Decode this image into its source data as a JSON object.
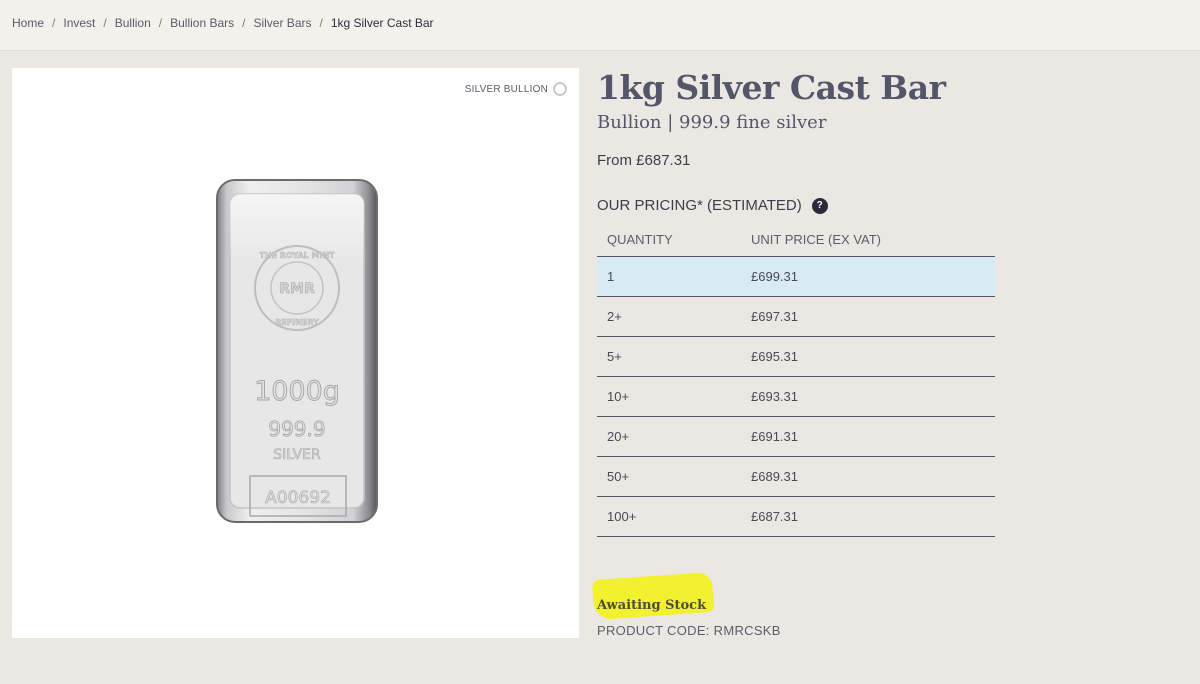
{
  "breadcrumb": {
    "items": [
      "Home",
      "Invest",
      "Bullion",
      "Bullion Bars",
      "Silver Bars"
    ],
    "current": "1kg Silver Cast Bar",
    "separator": "/"
  },
  "image": {
    "badge_label": "SILVER BULLION",
    "bar_text": {
      "brand_top": "THE ROYAL MINT",
      "brand_bottom": "REFINERY",
      "logo": "RMR",
      "weight": "1000g",
      "purity": "999.9",
      "metal": "SILVER",
      "serial": "A00692"
    }
  },
  "product": {
    "title": "1kg Silver Cast Bar",
    "subtitle": "Bullion | 999.9 fine silver",
    "from_price": "From £687.31",
    "pricing_heading": "OUR PRICING* (ESTIMATED)",
    "help_icon": "?",
    "pricing_table": {
      "headers": [
        "QUANTITY",
        "UNIT PRICE (EX VAT)"
      ],
      "rows": [
        {
          "qty": "1",
          "price": "£699.31",
          "selected": true
        },
        {
          "qty": "2+",
          "price": "£697.31",
          "selected": false
        },
        {
          "qty": "5+",
          "price": "£695.31",
          "selected": false
        },
        {
          "qty": "10+",
          "price": "£693.31",
          "selected": false
        },
        {
          "qty": "20+",
          "price": "£691.31",
          "selected": false
        },
        {
          "qty": "50+",
          "price": "£689.31",
          "selected": false
        },
        {
          "qty": "100+",
          "price": "£687.31",
          "selected": false
        }
      ]
    },
    "stock_status": "Awaiting Stock",
    "product_code": "PRODUCT CODE: RMRCSKB"
  },
  "colors": {
    "page_bg": "#ebe8e3",
    "selected_row": "#d8ebf4",
    "highlight": "#f2f211",
    "title": "#55556a"
  }
}
